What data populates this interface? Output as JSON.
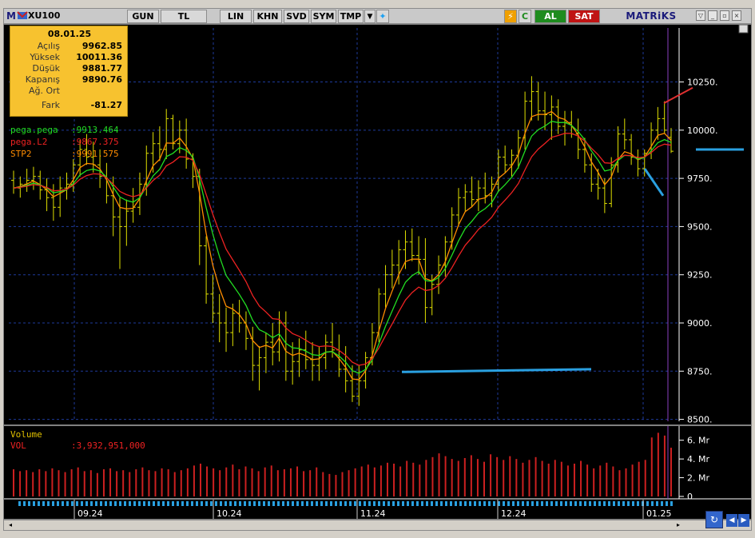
{
  "toolbar": {
    "symbol": "XU100",
    "period": "GUN",
    "currency": "TL",
    "lin": "LIN",
    "khn": "KHN",
    "svd": "SVD",
    "sym": "SYM",
    "tmp": "TMP",
    "al": "AL",
    "sat": "SAT",
    "brand": "MATRiKS",
    "m_logo": "M"
  },
  "info_box": {
    "date": "08.01.25",
    "rows": [
      {
        "label": "Açılış",
        "value": "9962.85"
      },
      {
        "label": "Yüksek",
        "value": "10011.36"
      },
      {
        "label": "Düşük",
        "value": "9881.77"
      },
      {
        "label": "Kapanış",
        "value": "9890.76"
      },
      {
        "label": "Ağ. Ort",
        "value": ""
      },
      {
        "label": "Fark",
        "value": "-81.27"
      }
    ]
  },
  "legend": {
    "pega": {
      "name": "pega.pega",
      "value": ":9913.464",
      "color": "#22dd22"
    },
    "pegaL2": {
      "name": "pega.L2",
      "value": ":9867.375",
      "color": "#ee2222"
    },
    "stp2": {
      "name": "STP2",
      "value": ":9991.575",
      "color": "#ff8c00"
    },
    "volume_title": "Volume",
    "vol_name": "VOL",
    "vol_value": ":3,932,951,000"
  },
  "colors": {
    "bar": "#e0e000",
    "green": "#22dd22",
    "red": "#ee2222",
    "orange": "#ff8c00",
    "grid": "#1e3a9a",
    "axis": "#ffffff",
    "volume": "#cc2020",
    "annotation_blue": "#2aa0e0",
    "annotation_red": "#e03030"
  },
  "chart_data": [
    {
      "type": "ohlc",
      "title": "",
      "y_ticks": [
        "10250.",
        "10000.",
        "9750.",
        "9500.",
        "9250.",
        "9000.",
        "8750.",
        "8500."
      ],
      "ylim": [
        8490,
        10530
      ],
      "x_labels": [
        "09.24",
        "10.24",
        "11.24",
        "12.24",
        "01.25"
      ],
      "grid": true,
      "bars": [
        {
          "o": 9740,
          "h": 9790,
          "l": 9670,
          "c": 9700
        },
        {
          "o": 9700,
          "h": 9760,
          "l": 9650,
          "c": 9720
        },
        {
          "o": 9720,
          "h": 9800,
          "l": 9680,
          "c": 9740
        },
        {
          "o": 9740,
          "h": 9810,
          "l": 9690,
          "c": 9760
        },
        {
          "o": 9760,
          "h": 9790,
          "l": 9640,
          "c": 9690
        },
        {
          "o": 9690,
          "h": 9750,
          "l": 9580,
          "c": 9650
        },
        {
          "o": 9650,
          "h": 9720,
          "l": 9530,
          "c": 9600
        },
        {
          "o": 9600,
          "h": 9760,
          "l": 9550,
          "c": 9700
        },
        {
          "o": 9700,
          "h": 9780,
          "l": 9640,
          "c": 9720
        },
        {
          "o": 9720,
          "h": 9850,
          "l": 9680,
          "c": 9820
        },
        {
          "o": 9820,
          "h": 9950,
          "l": 9760,
          "c": 9900
        },
        {
          "o": 9900,
          "h": 9980,
          "l": 9820,
          "c": 9860
        },
        {
          "o": 9860,
          "h": 9940,
          "l": 9780,
          "c": 9820
        },
        {
          "o": 9820,
          "h": 9900,
          "l": 9700,
          "c": 9760
        },
        {
          "o": 9760,
          "h": 9830,
          "l": 9620,
          "c": 9660
        },
        {
          "o": 9660,
          "h": 9760,
          "l": 9450,
          "c": 9550
        },
        {
          "o": 9550,
          "h": 9650,
          "l": 9280,
          "c": 9500
        },
        {
          "o": 9500,
          "h": 9640,
          "l": 9400,
          "c": 9580
        },
        {
          "o": 9580,
          "h": 9700,
          "l": 9520,
          "c": 9600
        },
        {
          "o": 9600,
          "h": 9780,
          "l": 9560,
          "c": 9720
        },
        {
          "o": 9720,
          "h": 9920,
          "l": 9660,
          "c": 9880
        },
        {
          "o": 9880,
          "h": 9990,
          "l": 9780,
          "c": 9930
        },
        {
          "o": 9930,
          "h": 10020,
          "l": 9840,
          "c": 9900
        },
        {
          "o": 9900,
          "h": 10110,
          "l": 9850,
          "c": 10060
        },
        {
          "o": 10060,
          "h": 10080,
          "l": 9900,
          "c": 9930
        },
        {
          "o": 9930,
          "h": 10050,
          "l": 9880,
          "c": 10000
        },
        {
          "o": 10000,
          "h": 10060,
          "l": 9800,
          "c": 9850
        },
        {
          "o": 9850,
          "h": 9880,
          "l": 9700,
          "c": 9760
        },
        {
          "o": 9760,
          "h": 9800,
          "l": 9300,
          "c": 9400
        },
        {
          "o": 9400,
          "h": 9450,
          "l": 9100,
          "c": 9150
        },
        {
          "o": 9150,
          "h": 9250,
          "l": 9000,
          "c": 9050
        },
        {
          "o": 9050,
          "h": 9150,
          "l": 8900,
          "c": 9000
        },
        {
          "o": 9000,
          "h": 9080,
          "l": 8850,
          "c": 8950
        },
        {
          "o": 8950,
          "h": 9100,
          "l": 8880,
          "c": 9050
        },
        {
          "o": 9050,
          "h": 9120,
          "l": 8950,
          "c": 9000
        },
        {
          "o": 9000,
          "h": 9060,
          "l": 8860,
          "c": 8920
        },
        {
          "o": 8920,
          "h": 8980,
          "l": 8700,
          "c": 8780
        },
        {
          "o": 8780,
          "h": 8880,
          "l": 8650,
          "c": 8820
        },
        {
          "o": 8820,
          "h": 8950,
          "l": 8740,
          "c": 8900
        },
        {
          "o": 8900,
          "h": 9000,
          "l": 8780,
          "c": 8850
        },
        {
          "o": 8850,
          "h": 9060,
          "l": 8800,
          "c": 9000
        },
        {
          "o": 9000,
          "h": 9060,
          "l": 8700,
          "c": 8750
        },
        {
          "o": 8750,
          "h": 8900,
          "l": 8680,
          "c": 8800
        },
        {
          "o": 8800,
          "h": 8920,
          "l": 8720,
          "c": 8860
        },
        {
          "o": 8860,
          "h": 8960,
          "l": 8760,
          "c": 8810
        },
        {
          "o": 8810,
          "h": 8900,
          "l": 8700,
          "c": 8780
        },
        {
          "o": 8780,
          "h": 8880,
          "l": 8700,
          "c": 8820
        },
        {
          "o": 8820,
          "h": 8940,
          "l": 8760,
          "c": 8900
        },
        {
          "o": 8900,
          "h": 9000,
          "l": 8820,
          "c": 8860
        },
        {
          "o": 8860,
          "h": 8940,
          "l": 8720,
          "c": 8760
        },
        {
          "o": 8760,
          "h": 8880,
          "l": 8640,
          "c": 8700
        },
        {
          "o": 8700,
          "h": 8780,
          "l": 8590,
          "c": 8620
        },
        {
          "o": 8620,
          "h": 8780,
          "l": 8570,
          "c": 8700
        },
        {
          "o": 8700,
          "h": 8850,
          "l": 8660,
          "c": 8820
        },
        {
          "o": 8820,
          "h": 9000,
          "l": 8780,
          "c": 8950
        },
        {
          "o": 8950,
          "h": 9180,
          "l": 8900,
          "c": 9150
        },
        {
          "o": 9150,
          "h": 9300,
          "l": 9080,
          "c": 9250
        },
        {
          "o": 9250,
          "h": 9380,
          "l": 9180,
          "c": 9300
        },
        {
          "o": 9300,
          "h": 9430,
          "l": 9200,
          "c": 9380
        },
        {
          "o": 9380,
          "h": 9480,
          "l": 9280,
          "c": 9420
        },
        {
          "o": 9420,
          "h": 9490,
          "l": 9320,
          "c": 9350
        },
        {
          "o": 9350,
          "h": 9450,
          "l": 9250,
          "c": 9330
        },
        {
          "o": 9330,
          "h": 9440,
          "l": 9000,
          "c": 9080
        },
        {
          "o": 9080,
          "h": 9250,
          "l": 9040,
          "c": 9200
        },
        {
          "o": 9200,
          "h": 9350,
          "l": 9150,
          "c": 9300
        },
        {
          "o": 9300,
          "h": 9450,
          "l": 9240,
          "c": 9420
        },
        {
          "o": 9420,
          "h": 9600,
          "l": 9380,
          "c": 9560
        },
        {
          "o": 9560,
          "h": 9700,
          "l": 9500,
          "c": 9650
        },
        {
          "o": 9650,
          "h": 9720,
          "l": 9580,
          "c": 9680
        },
        {
          "o": 9680,
          "h": 9760,
          "l": 9600,
          "c": 9640
        },
        {
          "o": 9640,
          "h": 9740,
          "l": 9580,
          "c": 9700
        },
        {
          "o": 9700,
          "h": 9780,
          "l": 9620,
          "c": 9660
        },
        {
          "o": 9660,
          "h": 9760,
          "l": 9600,
          "c": 9720
        },
        {
          "o": 9720,
          "h": 9900,
          "l": 9680,
          "c": 9860
        },
        {
          "o": 9860,
          "h": 9920,
          "l": 9780,
          "c": 9820
        },
        {
          "o": 9820,
          "h": 9900,
          "l": 9760,
          "c": 9870
        },
        {
          "o": 9870,
          "h": 10000,
          "l": 9800,
          "c": 9960
        },
        {
          "o": 9960,
          "h": 10200,
          "l": 9900,
          "c": 10150
        },
        {
          "o": 10150,
          "h": 10280,
          "l": 10050,
          "c": 10200
        },
        {
          "o": 10200,
          "h": 10250,
          "l": 10050,
          "c": 10100
        },
        {
          "o": 10100,
          "h": 10200,
          "l": 10000,
          "c": 10080
        },
        {
          "o": 10080,
          "h": 10180,
          "l": 9950,
          "c": 10120
        },
        {
          "o": 10120,
          "h": 10160,
          "l": 9980,
          "c": 10020
        },
        {
          "o": 10020,
          "h": 10100,
          "l": 9920,
          "c": 10040
        },
        {
          "o": 10040,
          "h": 10100,
          "l": 9960,
          "c": 9980
        },
        {
          "o": 9980,
          "h": 10060,
          "l": 9850,
          "c": 9900
        },
        {
          "o": 9900,
          "h": 9960,
          "l": 9780,
          "c": 9820
        },
        {
          "o": 9820,
          "h": 9880,
          "l": 9680,
          "c": 9720
        },
        {
          "o": 9720,
          "h": 9800,
          "l": 9640,
          "c": 9700
        },
        {
          "o": 9700,
          "h": 9750,
          "l": 9570,
          "c": 9620
        },
        {
          "o": 9620,
          "h": 9860,
          "l": 9600,
          "c": 9820
        },
        {
          "o": 9820,
          "h": 10020,
          "l": 9780,
          "c": 9980
        },
        {
          "o": 9980,
          "h": 10060,
          "l": 9900,
          "c": 9950
        },
        {
          "o": 9950,
          "h": 9980,
          "l": 9820,
          "c": 9860
        },
        {
          "o": 9860,
          "h": 9900,
          "l": 9760,
          "c": 9800
        },
        {
          "o": 9800,
          "h": 9900,
          "l": 9760,
          "c": 9880
        },
        {
          "o": 9880,
          "h": 10040,
          "l": 9850,
          "c": 10000
        },
        {
          "o": 10000,
          "h": 10120,
          "l": 9950,
          "c": 10060
        },
        {
          "o": 10060,
          "h": 10150,
          "l": 9980,
          "c": 10000
        },
        {
          "o": 9962.85,
          "h": 10011.36,
          "l": 9881.77,
          "c": 9890.76
        }
      ]
    },
    {
      "type": "bar",
      "title": "Volume",
      "y_ticks": [
        "6. Mr",
        "4. Mr",
        "2. Mr",
        "0"
      ],
      "ylim": [
        0,
        7
      ],
      "values": [
        2.9,
        2.7,
        2.8,
        2.6,
        2.9,
        2.7,
        3.0,
        2.8,
        2.6,
        2.9,
        3.1,
        2.7,
        2.8,
        2.5,
        2.9,
        3.0,
        2.7,
        2.8,
        2.6,
        2.9,
        3.1,
        2.8,
        2.7,
        3.0,
        2.9,
        2.6,
        2.8,
        3.0,
        3.3,
        3.5,
        3.2,
        3.0,
        2.8,
        3.1,
        3.4,
        2.9,
        3.2,
        3.0,
        2.7,
        3.1,
        3.3,
        2.8,
        2.9,
        3.0,
        3.2,
        2.7,
        2.8,
        3.1,
        2.6,
        2.4,
        2.3,
        2.6,
        2.8,
        3.0,
        3.2,
        3.4,
        3.1,
        3.3,
        3.6,
        3.5,
        3.2,
        3.8,
        3.6,
        3.4,
        3.9,
        4.2,
        4.6,
        4.3,
        4.0,
        3.8,
        4.1,
        4.4,
        4.0,
        3.7,
        4.5,
        4.2,
        3.9,
        4.3,
        4.0,
        3.6,
        3.9,
        4.2,
        3.8,
        3.5,
        3.9,
        3.7,
        3.3,
        3.5,
        3.8,
        3.4,
        3.0,
        3.3,
        3.6,
        3.2,
        2.8,
        3.0,
        3.4,
        3.7,
        3.9,
        6.3,
        6.8,
        6.5,
        5.2
      ]
    }
  ]
}
